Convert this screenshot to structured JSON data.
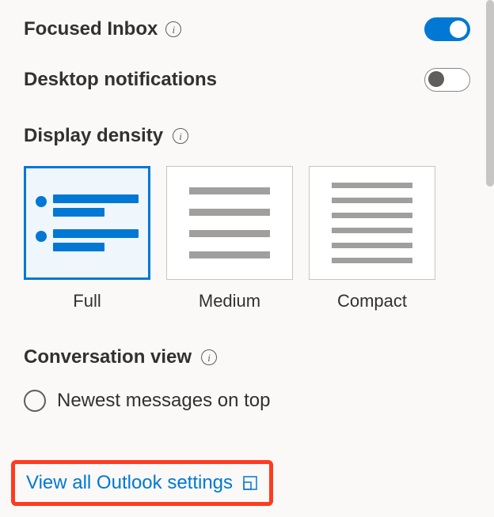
{
  "focused_inbox": {
    "label": "Focused Inbox",
    "enabled": true
  },
  "desktop_notifications": {
    "label": "Desktop notifications",
    "enabled": false
  },
  "display_density": {
    "label": "Display density",
    "options": {
      "full": "Full",
      "medium": "Medium",
      "compact": "Compact"
    },
    "selected": "full"
  },
  "conversation_view": {
    "label": "Conversation view",
    "options": {
      "newest_top": "Newest messages on top"
    }
  },
  "footer": {
    "view_all": "View all Outlook settings"
  },
  "colors": {
    "accent": "#0078d4",
    "highlight": "#ff3b1f"
  }
}
